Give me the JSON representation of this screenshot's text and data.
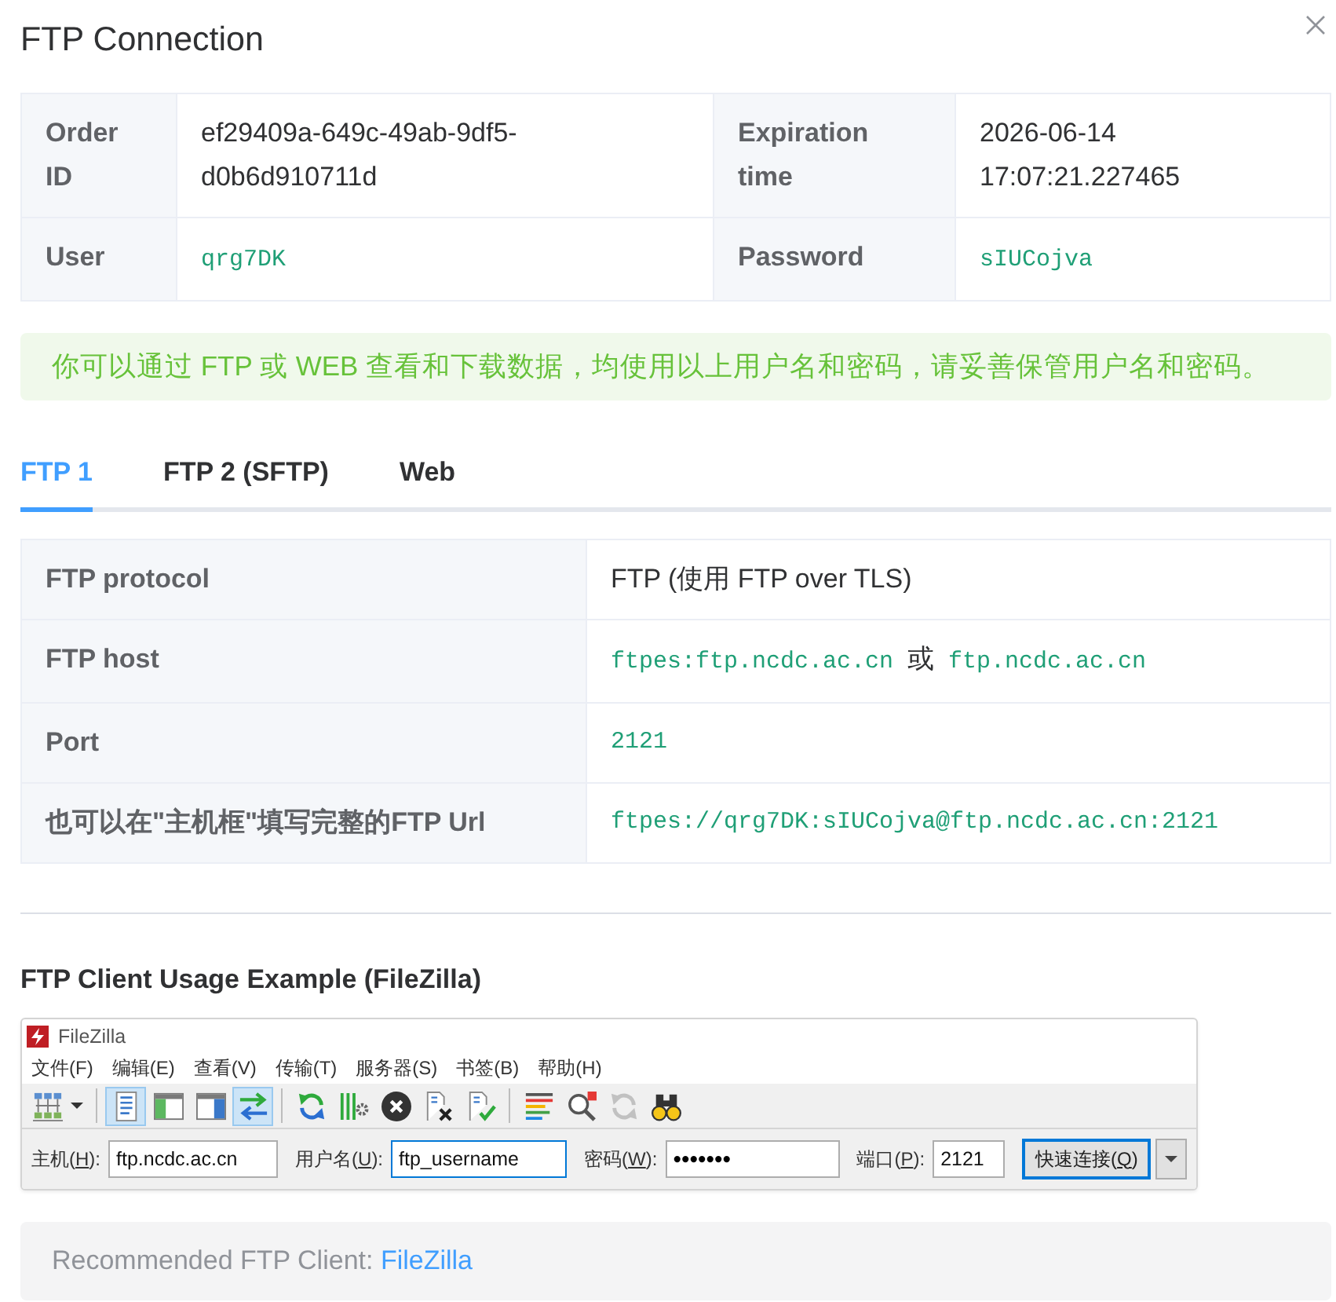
{
  "dialog": {
    "title": "FTP Connection"
  },
  "info": [
    {
      "label": "Order ID",
      "value": "ef29409a-649c-49ab-9df5-d0b6d910711d",
      "kind": "text"
    },
    {
      "label": "Expiration time",
      "value": "2026-06-14 17:07:21.227465",
      "kind": "text"
    },
    {
      "label": "User",
      "value": "qrg7DK",
      "kind": "code"
    },
    {
      "label": "Password",
      "value": "sIUCojva",
      "kind": "code"
    }
  ],
  "alert": {
    "text": "你可以通过 FTP 或 WEB 查看和下载数据，均使用以上用户名和密码，请妥善保管用户名和密码。"
  },
  "tabs": [
    {
      "label": "FTP 1",
      "selected": true
    },
    {
      "label": "FTP 2 (SFTP)",
      "selected": false
    },
    {
      "label": "Web",
      "selected": false
    }
  ],
  "ftp_table": [
    {
      "label": "FTP protocol",
      "value": [
        {
          "text": "FTP (使用 FTP over TLS)",
          "kind": "text"
        }
      ]
    },
    {
      "label": "FTP host",
      "value": [
        {
          "text": "ftpes:ftp.ncdc.ac.cn",
          "kind": "code"
        },
        {
          "text": "或",
          "kind": "text"
        },
        {
          "text": "ftp.ncdc.ac.cn",
          "kind": "code"
        }
      ]
    },
    {
      "label": "Port",
      "value": [
        {
          "text": "2121",
          "kind": "code"
        }
      ]
    },
    {
      "label": "也可以在\"主机框\"填写完整的FTP Url",
      "value": [
        {
          "text": "ftpes://qrg7DK:sIUCojva@ftp.ncdc.ac.cn:2121",
          "kind": "code"
        }
      ]
    }
  ],
  "example": {
    "title": "FTP Client Usage Example (FileZilla)",
    "window": {
      "title": "FileZilla",
      "menu": [
        "文件(F)",
        "编辑(E)",
        "查看(V)",
        "传输(T)",
        "服务器(S)",
        "书签(B)",
        "帮助(H)"
      ],
      "toolbar": [
        {
          "on": false,
          "disabled": false
        },
        {
          "on": true,
          "disabled": false
        },
        {
          "on": false,
          "disabled": false
        },
        {
          "on": false,
          "disabled": false
        },
        {
          "on": true,
          "disabled": false
        },
        {
          "on": false,
          "disabled": false
        },
        {
          "on": false,
          "disabled": false
        },
        {
          "on": false,
          "disabled": false
        },
        {
          "on": false,
          "disabled": false
        },
        {
          "on": false,
          "disabled": false
        },
        {
          "on": false,
          "disabled": false
        },
        {
          "on": false,
          "disabled": false
        },
        {
          "on": false,
          "disabled": true
        },
        {
          "on": false,
          "disabled": false
        }
      ],
      "quickconnect": {
        "fields": [
          {
            "label": [
              "主机(",
              "H",
              "):"
            ],
            "value": "ftp.ncdc.ac.cn",
            "focused": false
          },
          {
            "label": [
              "用户名(",
              "U",
              "):"
            ],
            "value": "ftp_username",
            "focused": true
          },
          {
            "label": [
              "密码(",
              "W",
              "):"
            ],
            "value": "•••••••",
            "focused": false
          },
          {
            "label": [
              "端口(",
              "P",
              "):"
            ],
            "value": "2121",
            "focused": false
          }
        ],
        "button": {
          "label": [
            "快速连接(",
            "Q",
            ")"
          ],
          "focused": true
        }
      }
    }
  },
  "tip": {
    "text": "Recommended FTP Client:",
    "link": "FileZilla"
  }
}
